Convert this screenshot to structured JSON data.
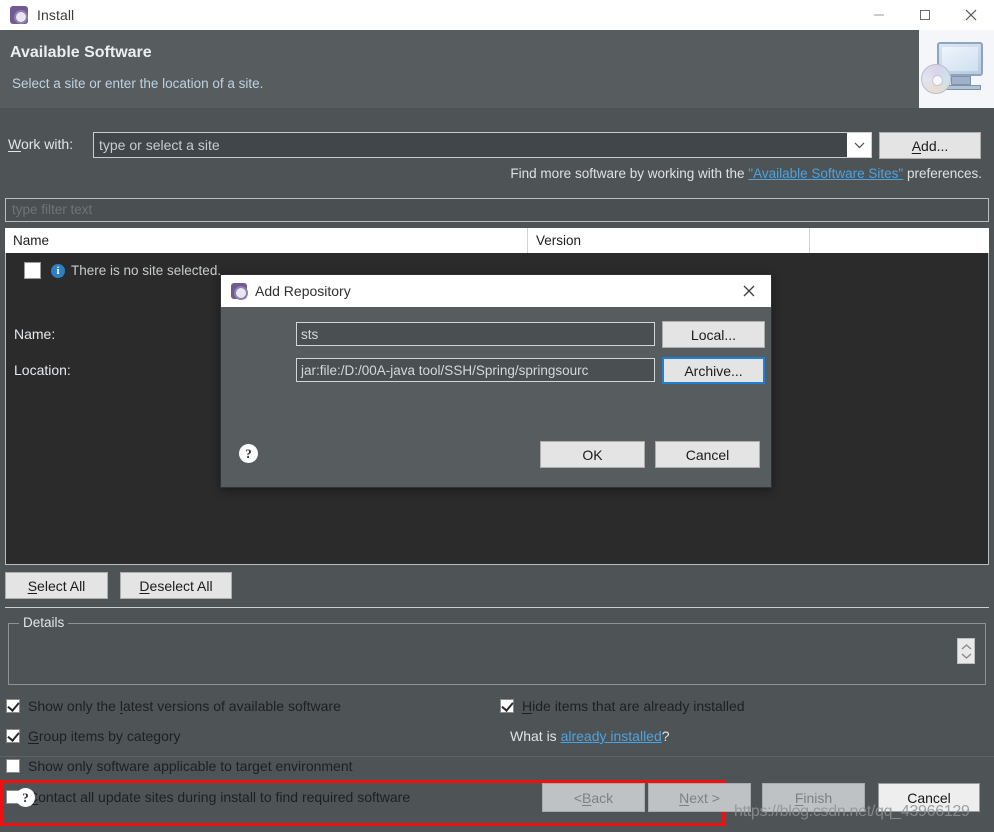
{
  "window": {
    "title": "Install",
    "icon": "install-gear-icon",
    "controls": {
      "minimize": "—",
      "maximize": "□",
      "close": "✕"
    }
  },
  "header": {
    "title": "Available Software",
    "subtitle": "Select a site or enter the location of a site.",
    "banner_icon": "monitor-with-cd-icon"
  },
  "work_with": {
    "label_pre": "W",
    "label_post": "ork with:",
    "value": "type or select a site",
    "dropdown_icon": "chevron-down-icon",
    "add_button": {
      "pre": "A",
      "post": "dd..."
    }
  },
  "find_more": {
    "before": "Find more software by working with the ",
    "link": "\"Available Software Sites\"",
    "after": " preferences."
  },
  "filter": {
    "placeholder": "type filter text"
  },
  "table": {
    "columns": [
      "Name",
      "Version",
      ""
    ],
    "rows": [
      {
        "icon": "info-icon",
        "label": "There is no site selected."
      }
    ]
  },
  "list_buttons": {
    "select_all": {
      "pre": "S",
      "post": "elect All"
    },
    "deselect_all": {
      "pre": "D",
      "post": "eselect All"
    }
  },
  "details": {
    "legend": "Details",
    "spinner_icon": "spinner-up-down-icon"
  },
  "options": {
    "show_latest": {
      "checked": true,
      "pre": "Show only the ",
      "key": "l",
      "post": "atest versions of available software"
    },
    "group_by_category": {
      "checked": true,
      "pre": "",
      "key": "G",
      "post": "roup items by category"
    },
    "show_applicable": {
      "checked": false,
      "pre": "",
      "key": "S",
      "post": "how only software applicable to target environment"
    },
    "contact_all": {
      "checked": false,
      "pre": "",
      "key": "C",
      "post": "ontact all update sites during install to find required software"
    },
    "hide_installed": {
      "checked": true,
      "pre": "",
      "key": "H",
      "post": "ide items that are already installed"
    },
    "what_is": {
      "before": "What is ",
      "link": "already installed",
      "after": "?"
    }
  },
  "highlight": {
    "color": "#ee1111",
    "target": "contact-all-update-sites-checkbox"
  },
  "footer": {
    "help_icon": "help-icon",
    "back": {
      "label": "< Back",
      "pre": "< ",
      "key": "B",
      "post": "ack",
      "disabled": true
    },
    "next": {
      "label": "Next >",
      "pre": "",
      "key": "N",
      "post": "ext >",
      "disabled": true
    },
    "finish": {
      "label": "Finish",
      "pre": "",
      "key": "F",
      "post": "inish",
      "disabled": true
    },
    "cancel": {
      "label": "Cancel",
      "disabled": false
    }
  },
  "watermark": "https://blog.csdn.net/qq_43966129",
  "dialog": {
    "title": "Add Repository",
    "icon": "repository-gear-icon",
    "close_icon": "close-icon",
    "name": {
      "label": "Name:",
      "value": "sts"
    },
    "location": {
      "label": "Location:",
      "value": "jar:file:/D:/00A-java tool/SSH/Spring/springsourc"
    },
    "local_button": "Local...",
    "archive_button": "Archive...",
    "help_icon": "help-icon",
    "ok_button": "OK",
    "cancel_button": "Cancel",
    "focus_ring_color": "#1f7fd4"
  }
}
